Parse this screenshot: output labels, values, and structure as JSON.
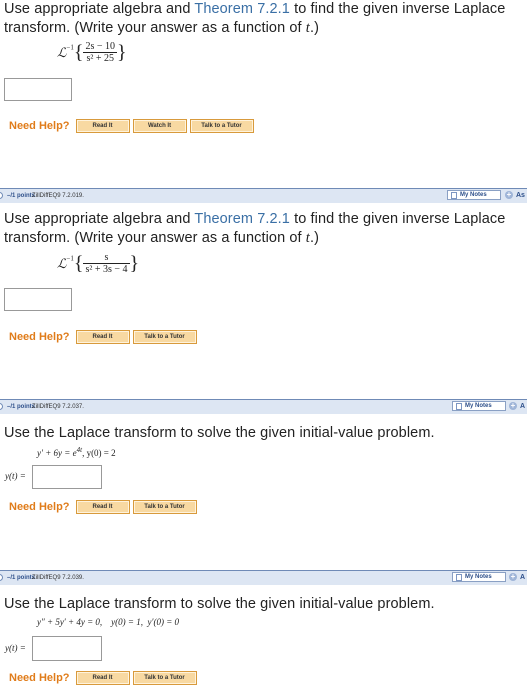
{
  "q1": {
    "text_pre": "Use appropriate algebra and ",
    "theorem": "Theorem 7.2.1",
    "text_post": " to find the given inverse Laplace transform. (Write your answer as a function of ",
    "var": "t",
    "text_end": ".)",
    "L": "ℒ",
    "L_sup": "−1",
    "numerator": "2s − 10",
    "denominator": "s² + 25",
    "need_help": "Need Help?",
    "buttons": [
      "Read It",
      "Watch It",
      "Talk to a Tutor"
    ]
  },
  "q2_header": {
    "points": "–/1 points",
    "ident": "ZillDiffEQ9 7.2.019.",
    "my_notes": "My Notes",
    "ask": "As"
  },
  "q2": {
    "text_pre": "Use appropriate algebra and ",
    "theorem": "Theorem 7.2.1",
    "text_post": " to find the given inverse Laplace transform. (Write your answer as a function of ",
    "var": "t",
    "text_end": ".)",
    "L": "ℒ",
    "L_sup": "−1",
    "numerator": "s",
    "denominator": "s² + 3s − 4",
    "need_help": "Need Help?",
    "buttons": [
      "Read It",
      "Talk to a Tutor"
    ]
  },
  "q3_header": {
    "points": "–/1 points",
    "ident": "ZillDiffEQ9 7.2.037.",
    "my_notes": "My Notes",
    "ask": "A"
  },
  "q3": {
    "text": "Use the Laplace transform to solve the given initial-value problem.",
    "equation_a": "y′ + 6y = e",
    "equation_sup": "4t",
    "equation_b": ",   y(0) = 2",
    "answer_label": "y(t) =",
    "need_help": "Need Help?",
    "buttons": [
      "Read It",
      "Talk to a Tutor"
    ]
  },
  "q4_header": {
    "points": "–/1 points",
    "ident": "ZillDiffEQ9 7.2.039.",
    "my_notes": "My Notes",
    "ask": "A"
  },
  "q4": {
    "text": "Use the Laplace transform to solve the given initial-value problem.",
    "equation": "y″ + 5y′ + 4y = 0,    y(0) = 1,  y′(0) = 0",
    "answer_label": "y(t) =",
    "need_help": "Need Help?",
    "buttons": [
      "Read It",
      "Talk to a Tutor"
    ]
  }
}
